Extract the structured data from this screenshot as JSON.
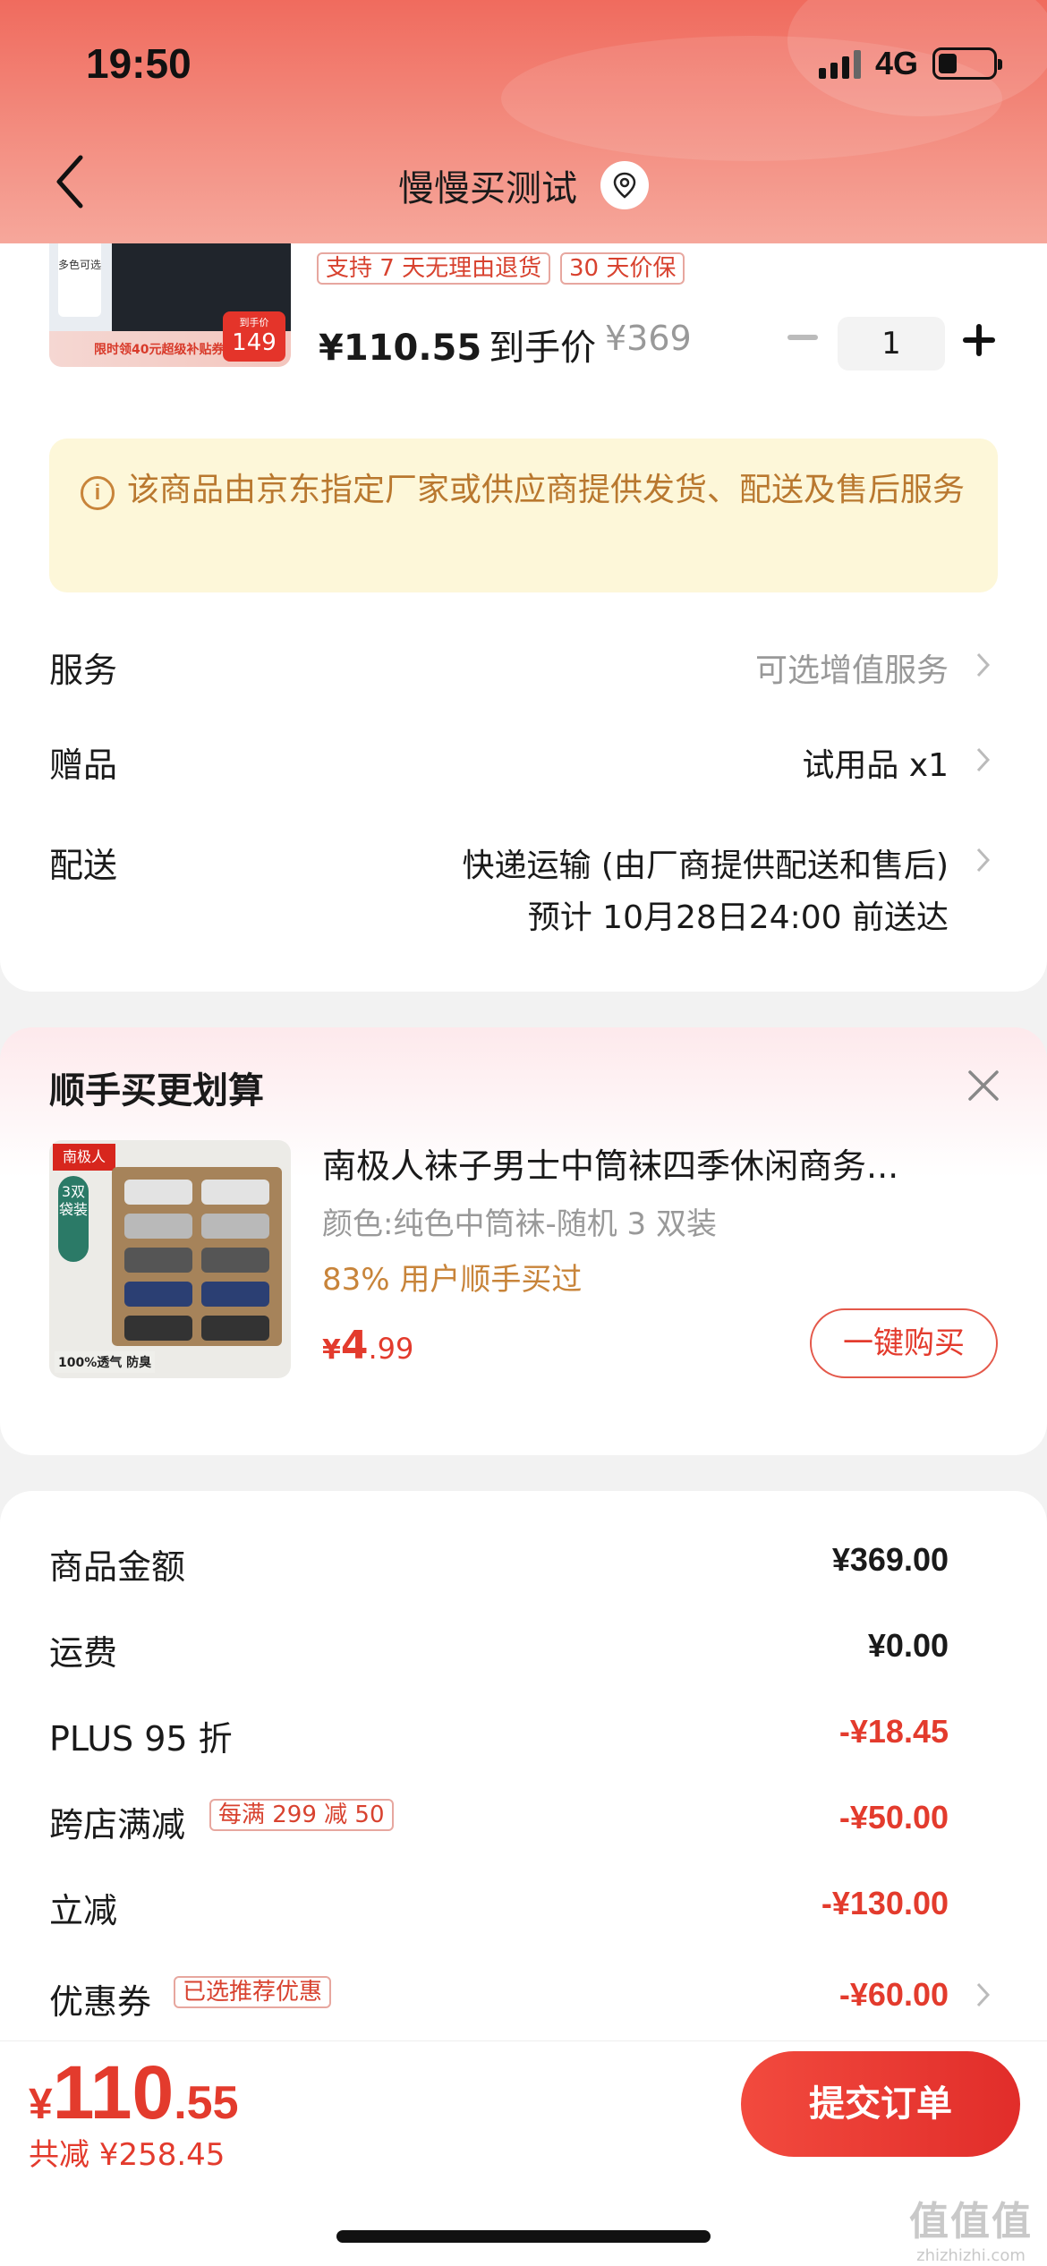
{
  "status_bar": {
    "time": "19:50",
    "network": "4G",
    "battery_level": 0.35
  },
  "header": {
    "title": "慢慢买测试"
  },
  "product": {
    "image_texts": {
      "tag": "多色可选",
      "promo": "限时领40元超级补贴券",
      "price_label": "到手价",
      "price": "149"
    },
    "tags": [
      "支持 7 天无理由退货",
      "30 天价保"
    ],
    "price": "¥110.55",
    "price_label": "到手价",
    "original_price": "¥369",
    "quantity": "1"
  },
  "notice": {
    "icon": "info-icon",
    "text": "该商品由京东指定厂家或供应商提供发货、配送及售后服务"
  },
  "rows": {
    "service": {
      "label": "服务",
      "value": "可选增值服务"
    },
    "gift": {
      "label": "赠品",
      "value": "试用品 x1"
    },
    "delivery": {
      "label": "配送",
      "value": "快递运输 (由厂商提供配送和售后)",
      "sub": "预计 10月28日24:00 前送达"
    }
  },
  "recommend": {
    "title": "顺手买更划算",
    "image_texts": {
      "brand": "南极人",
      "badge": "3双袋装",
      "feature": "100%透气 防臭"
    },
    "name": "南极人袜子男士中筒袜四季休闲商务...",
    "spec": "颜色:纯色中筒袜-随机 3 双装",
    "hint": "83% 用户顺手买过",
    "price_currency": "¥",
    "price_int": "4",
    "price_dec": ".99",
    "buy_label": "一键购买"
  },
  "summary": {
    "items": [
      {
        "label": "商品金额",
        "value": "¥369.00",
        "tone": "black"
      },
      {
        "label": "运费",
        "value": "¥0.00",
        "tone": "black"
      },
      {
        "label": "PLUS 95 折",
        "value": "-¥18.45",
        "tone": "red"
      },
      {
        "label": "跨店满减",
        "chip": "每满 299 减 50",
        "value": "-¥50.00",
        "tone": "red"
      },
      {
        "label": "立减",
        "value": "-¥130.00",
        "tone": "red"
      },
      {
        "label": "优惠券",
        "chip": "已选推荐优惠",
        "value": "-¥60.00",
        "tone": "red"
      }
    ]
  },
  "bottom": {
    "currency": "¥",
    "total_int": "110",
    "total_dec": ".55",
    "saved": "共减 ¥258.45",
    "submit_label": "提交订单"
  },
  "watermark": {
    "line1": "值值值",
    "line2": "zhizhizhi.com"
  },
  "colors": {
    "accent": "#e33b2d",
    "header_top": "#f06b5e",
    "notice_bg": "#fdf7d9",
    "notice_text": "#b9782f"
  }
}
